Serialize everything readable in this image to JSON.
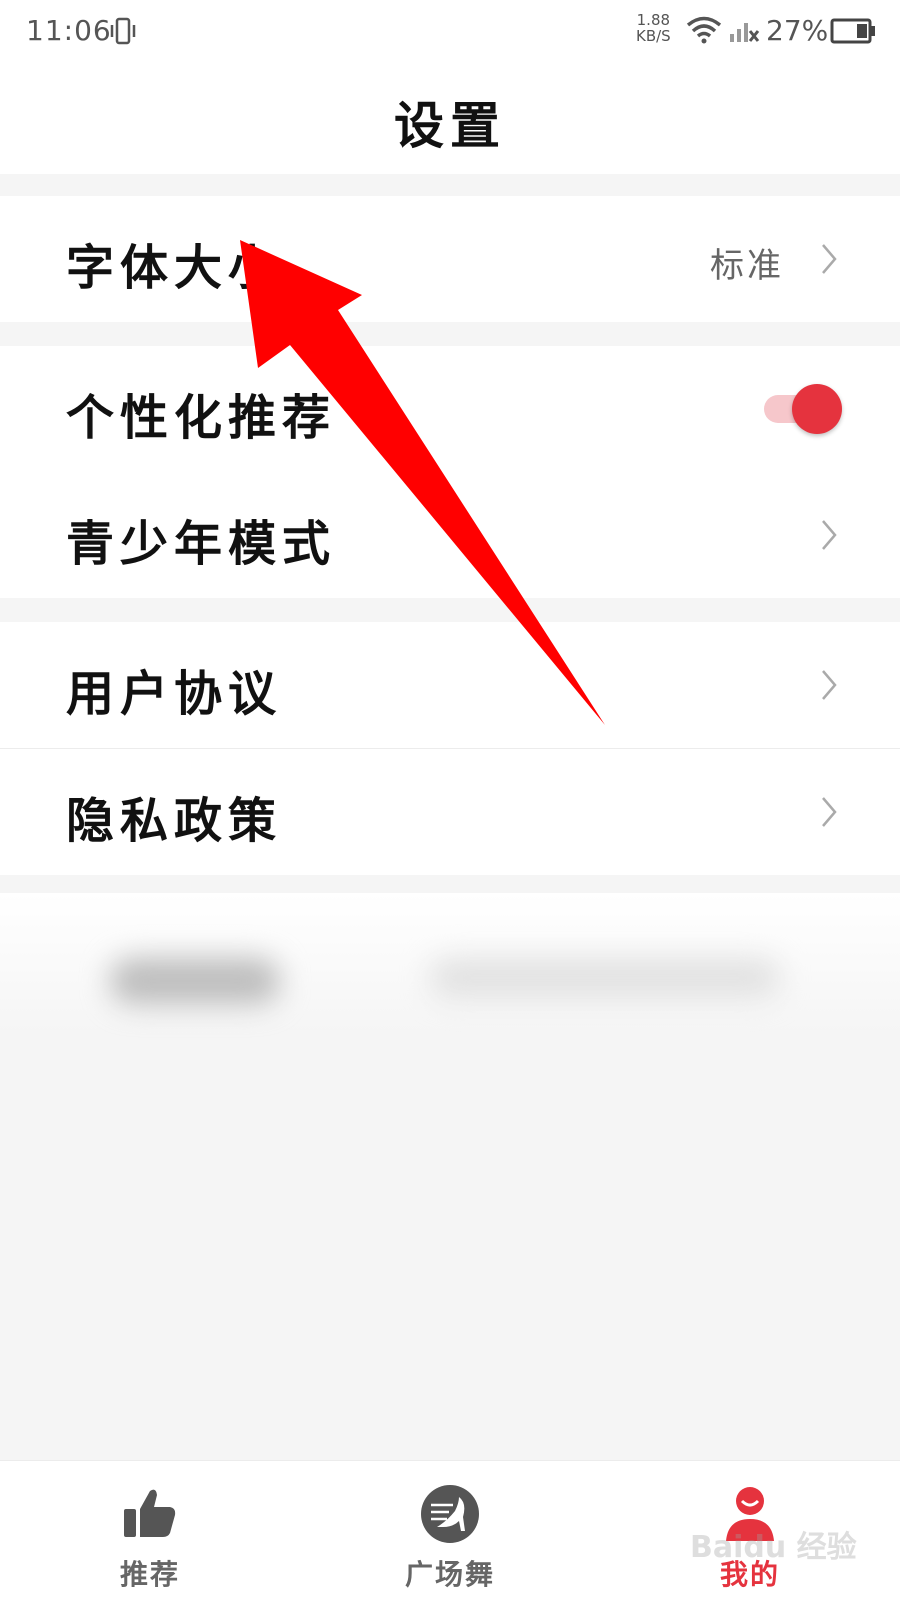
{
  "status_bar": {
    "time": "11:06",
    "speed_value": "1.88",
    "speed_unit": "KB/S",
    "battery": "27%",
    "icons": [
      "vibrate-icon",
      "wifi-icon",
      "signal-icon",
      "battery-icon"
    ]
  },
  "header": {
    "title": "设置"
  },
  "sections": {
    "font": {
      "label": "字体大小",
      "value": "标准"
    },
    "personal": {
      "label": "个性化推荐",
      "toggle_on": true
    },
    "youth": {
      "label": "青少年模式"
    },
    "agreement": {
      "label": "用户协议"
    },
    "privacy": {
      "label": "隐私政策"
    }
  },
  "tabs": [
    {
      "label": "推荐",
      "icon": "thumbs-up-icon",
      "active": false
    },
    {
      "label": "广场舞",
      "icon": "high-heel-icon",
      "active": false
    },
    {
      "label": "我的",
      "icon": "profile-icon",
      "active": true
    }
  ],
  "watermark": "Baidu 经验",
  "colors": {
    "accent": "#e5333e",
    "toggle_track": "#f6c7cb",
    "arrow": "#ff0000",
    "background": "#f5f5f5"
  }
}
